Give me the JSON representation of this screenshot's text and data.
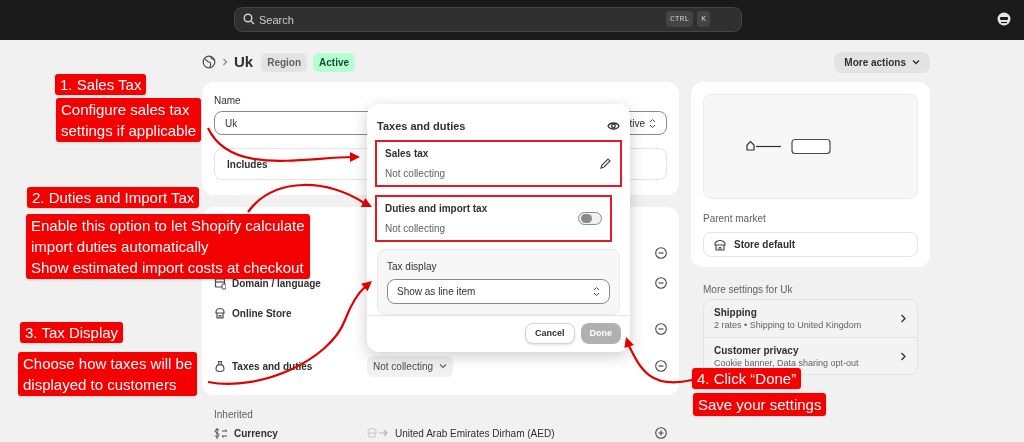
{
  "top_bar": {
    "search": {
      "placeholder": "Search"
    },
    "shortcut_keys": [
      "CTRL",
      "K"
    ]
  },
  "header": {
    "title": "Uk",
    "badges": [
      {
        "label": "Region",
        "kind": "neutral"
      },
      {
        "label": "Active",
        "kind": "success"
      }
    ],
    "more_actions": "More actions"
  },
  "details_card": {
    "name_label": "Name",
    "name_value": "Uk",
    "status_select": "tive",
    "includes_label": "Includes"
  },
  "settings_card": {
    "rows": [
      {},
      {
        "label": "Domain / language"
      },
      {
        "label": "Online Store"
      },
      {
        "label": "Taxes and duties",
        "value": "Not collecting"
      }
    ]
  },
  "inherited": {
    "label": "Inherited",
    "rows": [
      {
        "label": "Currency",
        "value": "United Arab Emirates Dirham (AED)"
      }
    ]
  },
  "side_card": {
    "parent_market_label": "Parent market",
    "parent_market": "Store default"
  },
  "more_settings": {
    "title": "More settings for Uk",
    "items": [
      {
        "title": "Shipping",
        "subtitle": "2 rates • Shipping to United Kingdom"
      },
      {
        "title": "Customer privacy",
        "subtitle": "Cookie banner, Data sharing opt-out"
      }
    ]
  },
  "popover": {
    "title": "Taxes and duties",
    "sections": [
      {
        "kind": "edit",
        "title": "Sales tax",
        "status": "Not collecting",
        "highlighted": true
      },
      {
        "kind": "toggle",
        "title": "Duties and import tax",
        "status": "Not collecting",
        "on": false,
        "highlighted": true
      }
    ],
    "tax_display": {
      "label": "Tax display",
      "value": "Show as line item"
    },
    "buttons": [
      {
        "label": "Cancel",
        "disabled": false
      },
      {
        "label": "Done",
        "disabled": true
      }
    ]
  },
  "annotations": [
    {
      "heading": "1. Sales Tax",
      "lines": [
        "Configure sales tax",
        "settings if applicable"
      ]
    },
    {
      "heading": "2. Duties and Import Tax",
      "lines": [
        "Enable this option to let Shopify calculate",
        "import duties automatically",
        "Show estimated import costs at checkout"
      ]
    },
    {
      "heading": "3. Tax Display",
      "lines": [
        "Choose how taxes will be",
        "displayed to customers"
      ]
    },
    {
      "heading": "4. Click “Done”",
      "lines": [
        "Save your settings"
      ]
    }
  ]
}
